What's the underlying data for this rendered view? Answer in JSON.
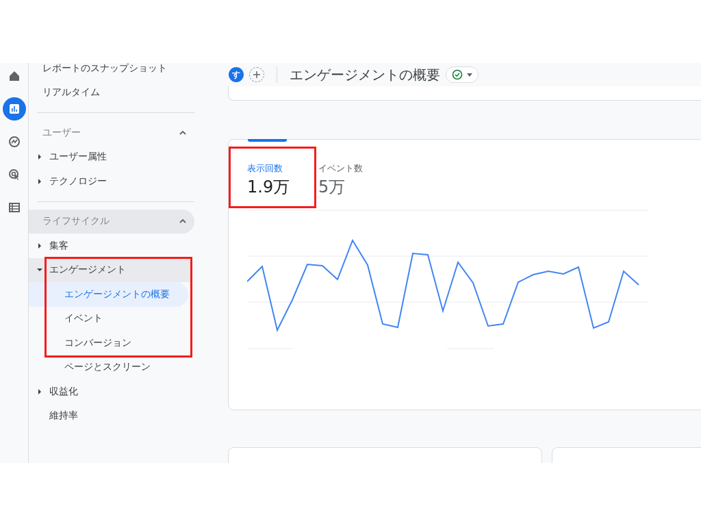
{
  "rail": [
    {
      "kind": "home",
      "selected": false
    },
    {
      "kind": "reports",
      "selected": true
    },
    {
      "kind": "explore",
      "selected": false
    },
    {
      "kind": "advertising",
      "selected": false
    },
    {
      "kind": "configure",
      "selected": false
    }
  ],
  "sidebar": {
    "top_items": [
      {
        "label": "レポートのスナップショット"
      },
      {
        "label": "リアルタイム"
      }
    ],
    "sections": [
      {
        "title": "ユーザー",
        "expanded": true,
        "highlighted": false,
        "items": [
          {
            "label": "ユーザー属性",
            "kind": "group",
            "expanded": false,
            "annotated": false
          },
          {
            "label": "テクノロジー",
            "kind": "group",
            "expanded": false,
            "annotated": false
          }
        ]
      },
      {
        "title": "ライフサイクル",
        "expanded": true,
        "highlighted": true,
        "items": [
          {
            "label": "集客",
            "kind": "group",
            "expanded": false,
            "annotated": false
          },
          {
            "label": "エンゲージメント",
            "kind": "group",
            "expanded": true,
            "annotated": true,
            "children": [
              {
                "label": "エンゲージメントの概要",
                "selected": true,
                "annotated": true
              },
              {
                "label": "イベント",
                "selected": false,
                "annotated": true
              },
              {
                "label": "コンバージョン",
                "selected": false,
                "annotated": true
              },
              {
                "label": "ページとスクリーン",
                "selected": false,
                "annotated": false
              }
            ]
          },
          {
            "label": "収益化",
            "kind": "group",
            "expanded": false,
            "annotated": false
          },
          {
            "label": "維持率",
            "kind": "link",
            "annotated": false
          }
        ]
      }
    ]
  },
  "header": {
    "avatar": "す",
    "title": "エンゲージメントの概要"
  },
  "metric_tabs": [
    {
      "label": "表示回数",
      "value": "1.9万",
      "selected": true,
      "annotated": true
    },
    {
      "label": "イベント数",
      "value": "5万",
      "selected": false,
      "annotated": false
    }
  ]
}
